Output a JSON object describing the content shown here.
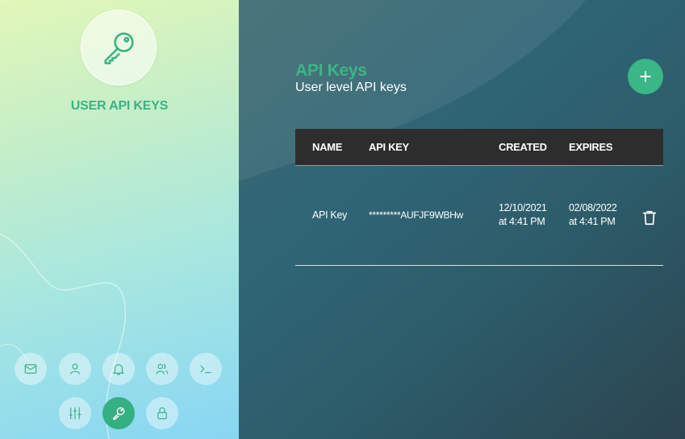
{
  "sidebar": {
    "title": "USER API KEYS",
    "nav": [
      {
        "name": "mail-icon",
        "active": false
      },
      {
        "name": "user-icon",
        "active": false
      },
      {
        "name": "bell-icon",
        "active": false
      },
      {
        "name": "users-icon",
        "active": false
      },
      {
        "name": "terminal-icon",
        "active": false
      },
      {
        "name": "sliders-icon",
        "active": false
      },
      {
        "name": "key-icon",
        "active": true
      },
      {
        "name": "lock-icon",
        "active": false
      }
    ]
  },
  "main": {
    "title": "API Keys",
    "subtitle": "User level API keys",
    "columns": {
      "name": "NAME",
      "api_key": "API KEY",
      "created": "CREATED",
      "expires": "EXPIRES"
    },
    "rows": [
      {
        "name": "API Key",
        "api_key": "*********AUFJF9WBHw",
        "created_date": "12/10/2021",
        "created_time": "at 4:41 PM",
        "expires_date": "02/08/2022",
        "expires_time": "at 4:41 PM"
      }
    ]
  },
  "colors": {
    "accent": "#3bb686",
    "header_bg": "#2d2d2d"
  }
}
